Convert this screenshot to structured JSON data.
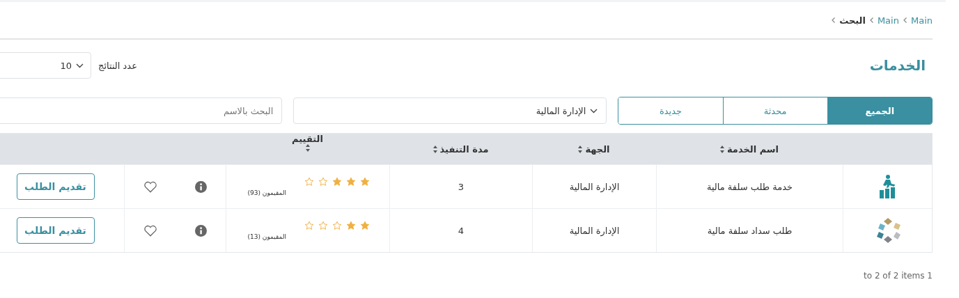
{
  "breadcrumb": [
    {
      "label": "Main",
      "current": false
    },
    {
      "label": "Main",
      "current": false
    },
    {
      "label": "البحث",
      "current": true
    }
  ],
  "title": "الخدمات",
  "page_size": {
    "label": "عدد النتائج",
    "value": "10"
  },
  "tabs": [
    {
      "label": "الجميع",
      "selected": true
    },
    {
      "label": "محدثة",
      "selected": false
    },
    {
      "label": "جديدة",
      "selected": false
    }
  ],
  "department_filter": {
    "value": "الإدارة المالية"
  },
  "search": {
    "placeholder": "البحث بالاسم"
  },
  "table": {
    "columns": [
      "اسم الخدمة",
      "الجهة",
      "مدة التنفيذ",
      "التقييم"
    ],
    "rows": [
      {
        "kind": "climber",
        "name": "خدمة طلب سلفة مالية",
        "entity": "الإدارة المالية",
        "duration": "3",
        "stars": 3,
        "raters": "المقيمون (93)",
        "action": "تقديم الطلب"
      },
      {
        "kind": "diamonds",
        "name": "طلب سداد سلفة مالية",
        "entity": "الإدارة المالية",
        "duration": "4",
        "stars": 2,
        "raters": "المقيمون (13)",
        "action": "تقديم الطلب"
      }
    ]
  },
  "pager_summary": "to 2 of 2 items 1"
}
